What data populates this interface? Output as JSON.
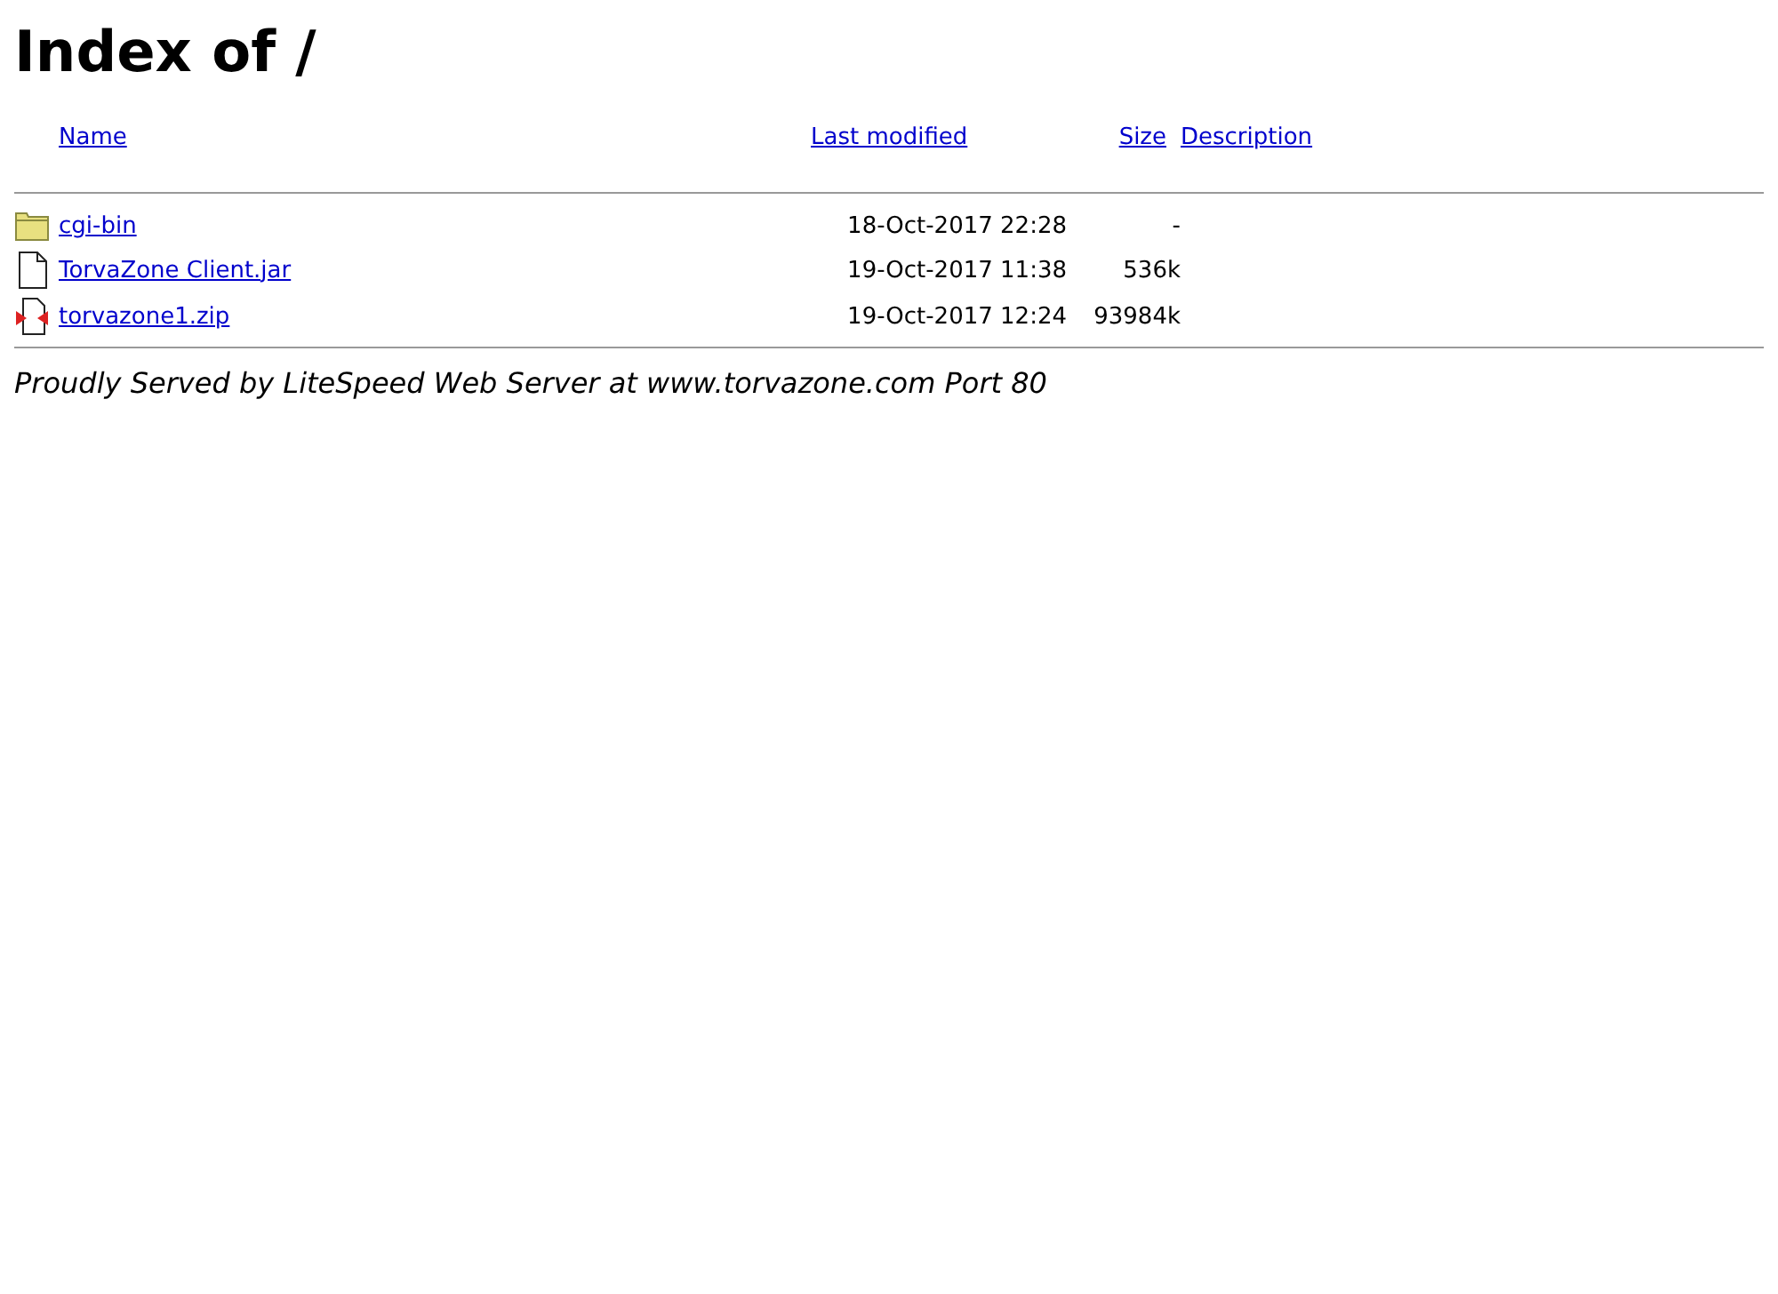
{
  "title": "Index of /",
  "columns": [
    "Name",
    "Last modified",
    "Size",
    "Description"
  ],
  "rows": [
    {
      "kind": "folder",
      "name": "cgi-bin",
      "modified": "18-Oct-2017 22:28",
      "size": "-"
    },
    {
      "kind": "file",
      "name": "TorvaZone Client.jar",
      "modified": "19-Oct-2017 11:38",
      "size": "536k"
    },
    {
      "kind": "archive",
      "name": "torvazone1.zip",
      "modified": "19-Oct-2017 12:24",
      "size": "93984k"
    }
  ],
  "footer": "Proudly Served by LiteSpeed Web Server at www.torvazone.com Port 80"
}
